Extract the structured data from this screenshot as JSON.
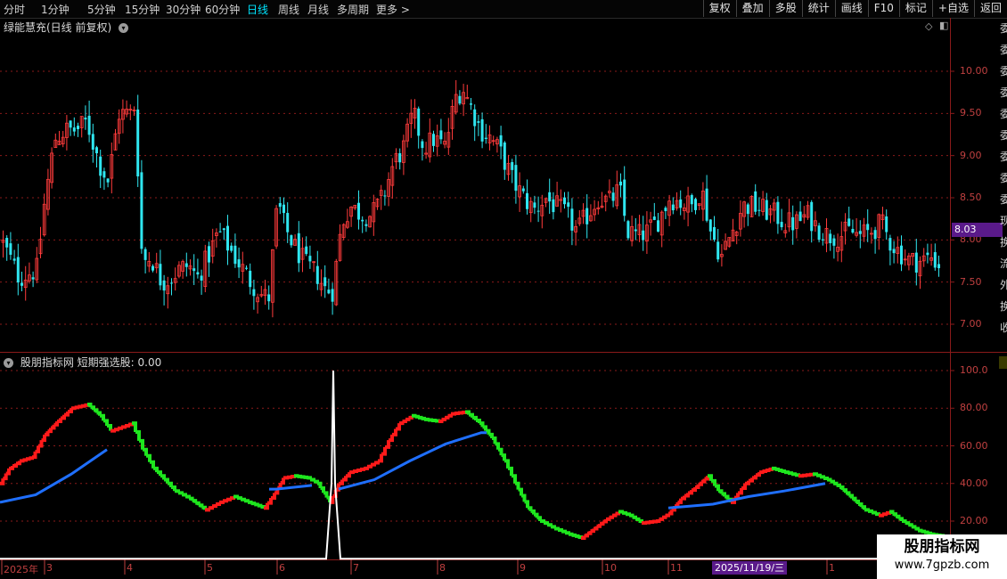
{
  "toolbar": {
    "periods": [
      "分时",
      "1分钟",
      "5分钟",
      "15分钟",
      "30分钟",
      "60分钟",
      "日线",
      "周线",
      "月线",
      "多周期",
      "更多"
    ],
    "active": "日线",
    "more_icon": "chevron-right-icon",
    "buttons": [
      "复权",
      "叠加",
      "多股",
      "统计",
      "画线",
      "F10",
      "标记",
      "+自选",
      "返回"
    ]
  },
  "main_chart": {
    "title": "绿能慧充(日线 前复权)",
    "current_price": "8.03",
    "price_ticks": [
      "10.00",
      "9.50",
      "9.00",
      "8.50",
      "8.00",
      "7.50",
      "7.00"
    ]
  },
  "indicator_chart": {
    "title": "股朋指标网  短期强选股: 0.00",
    "ticks": [
      "100.0",
      "80.00",
      "60.00",
      "40.00",
      "20.00"
    ]
  },
  "date_axis": {
    "labels": [
      "2025年",
      "3",
      "4",
      "5",
      "6",
      "7",
      "8",
      "9",
      "10",
      "11",
      "1"
    ],
    "cursor_date": "2025/11/19/三"
  },
  "side_panel": {
    "text": "委委委委委委委委委现换流外换收"
  },
  "watermark": {
    "line1": "股朋指标网",
    "line2": "www.7gpzb.com"
  },
  "colors": {
    "up": "#ff3b3b",
    "down": "#2fe6f0",
    "line_up": "#ff1a1a",
    "line_down": "#1ee61e",
    "line_blue": "#1f6fff",
    "grid": "#8a1a1a"
  },
  "chart_data": [
    {
      "type": "candlestick",
      "title": "绿能慧充(日线 前复权)",
      "ylim": [
        6.75,
        10.4
      ],
      "close_path": [
        [
          0,
          8.0
        ],
        [
          20,
          7.55
        ],
        [
          40,
          7.65
        ],
        [
          48,
          8.4
        ],
        [
          60,
          9.2
        ],
        [
          72,
          9.3
        ],
        [
          84,
          9.3
        ],
        [
          96,
          9.4
        ],
        [
          110,
          8.9
        ],
        [
          120,
          8.7
        ],
        [
          132,
          9.5
        ],
        [
          145,
          9.5
        ],
        [
          150,
          9.6
        ],
        [
          158,
          7.75
        ],
        [
          168,
          7.8
        ],
        [
          180,
          7.5
        ],
        [
          190,
          7.55
        ],
        [
          200,
          7.65
        ],
        [
          210,
          7.7
        ],
        [
          220,
          7.55
        ],
        [
          232,
          7.8
        ],
        [
          244,
          8.1
        ],
        [
          256,
          7.9
        ],
        [
          268,
          7.7
        ],
        [
          280,
          7.5
        ],
        [
          292,
          7.35
        ],
        [
          300,
          7.3
        ],
        [
          310,
          8.45
        ],
        [
          318,
          8.15
        ],
        [
          330,
          7.9
        ],
        [
          342,
          7.7
        ],
        [
          354,
          7.6
        ],
        [
          364,
          7.4
        ],
        [
          372,
          7.4
        ],
        [
          382,
          8.2
        ],
        [
          392,
          8.4
        ],
        [
          404,
          8.3
        ],
        [
          416,
          8.3
        ],
        [
          428,
          8.5
        ],
        [
          440,
          8.9
        ],
        [
          452,
          9.1
        ],
        [
          462,
          9.5
        ],
        [
          474,
          9.1
        ],
        [
          486,
          9.2
        ],
        [
          498,
          9.1
        ],
        [
          510,
          9.7
        ],
        [
          518,
          9.8
        ],
        [
          526,
          9.6
        ],
        [
          538,
          9.3
        ],
        [
          550,
          9.2
        ],
        [
          562,
          9.0
        ],
        [
          574,
          8.7
        ],
        [
          586,
          8.5
        ],
        [
          598,
          8.35
        ],
        [
          610,
          8.5
        ],
        [
          622,
          8.4
        ],
        [
          634,
          8.3
        ],
        [
          646,
          8.1
        ],
        [
          658,
          8.3
        ],
        [
          670,
          8.5
        ],
        [
          682,
          8.45
        ],
        [
          694,
          8.6
        ],
        [
          702,
          8.1
        ],
        [
          714,
          8.05
        ],
        [
          726,
          8.1
        ],
        [
          738,
          8.25
        ],
        [
          750,
          8.5
        ],
        [
          762,
          8.45
        ],
        [
          774,
          8.4
        ],
        [
          786,
          8.6
        ],
        [
          796,
          8.1
        ],
        [
          808,
          7.8
        ],
        [
          820,
          8.1
        ],
        [
          832,
          8.4
        ],
        [
          844,
          8.4
        ],
        [
          856,
          8.35
        ],
        [
          868,
          8.3
        ],
        [
          880,
          8.2
        ],
        [
          892,
          8.2
        ],
        [
          904,
          8.3
        ],
        [
          916,
          8.15
        ],
        [
          928,
          8.05
        ],
        [
          940,
          8.05
        ],
        [
          952,
          8.1
        ],
        [
          964,
          8.05
        ],
        [
          976,
          8.1
        ],
        [
          988,
          8.2
        ],
        [
          996,
          8.0
        ],
        [
          1008,
          7.85
        ],
        [
          1020,
          7.75
        ],
        [
          1032,
          7.75
        ],
        [
          1044,
          7.8
        ],
        [
          1056,
          7.65
        ]
      ]
    },
    {
      "type": "line",
      "title": "股朋指标网  短期强选股: 0.00",
      "ylim": [
        0,
        103
      ],
      "series": [
        {
          "color_by_slope": true,
          "points": [
            [
              0,
              40
            ],
            [
              10,
              48
            ],
            [
              22,
              52
            ],
            [
              36,
              54
            ],
            [
              50,
              66
            ],
            [
              64,
              73
            ],
            [
              80,
              80
            ],
            [
              98,
              82
            ],
            [
              112,
              76
            ],
            [
              124,
              68
            ],
            [
              136,
              70
            ],
            [
              148,
              72
            ],
            [
              160,
              58
            ],
            [
              172,
              48
            ],
            [
              184,
              42
            ],
            [
              196,
              36
            ],
            [
              212,
              32
            ],
            [
              230,
              26
            ],
            [
              246,
              30
            ],
            [
              262,
              33
            ],
            [
              278,
              30
            ],
            [
              296,
              27
            ],
            [
              308,
              35
            ],
            [
              318,
              43
            ],
            [
              330,
              44
            ],
            [
              344,
              43
            ],
            [
              356,
              40
            ],
            [
              370,
              30
            ],
            [
              380,
              40
            ],
            [
              392,
              46
            ],
            [
              408,
              48
            ],
            [
              424,
              52
            ],
            [
              436,
              63
            ],
            [
              448,
              72
            ],
            [
              462,
              76
            ],
            [
              476,
              74
            ],
            [
              492,
              73
            ],
            [
              506,
              77
            ],
            [
              522,
              78
            ],
            [
              538,
              72
            ],
            [
              552,
              64
            ],
            [
              566,
              52
            ],
            [
              578,
              40
            ],
            [
              592,
              27
            ],
            [
              606,
              20
            ],
            [
              622,
              16
            ],
            [
              638,
              13
            ],
            [
              652,
              11
            ],
            [
              666,
              16
            ],
            [
              680,
              21
            ],
            [
              694,
              25
            ],
            [
              706,
              23
            ],
            [
              720,
              19
            ],
            [
              736,
              20
            ],
            [
              750,
              24
            ],
            [
              764,
              32
            ],
            [
              780,
              38
            ],
            [
              794,
              44
            ],
            [
              806,
              36
            ],
            [
              820,
              30
            ],
            [
              836,
              40
            ],
            [
              852,
              46
            ],
            [
              866,
              48
            ],
            [
              880,
              46
            ],
            [
              896,
              44
            ],
            [
              912,
              45
            ],
            [
              928,
              42
            ],
            [
              942,
              38
            ],
            [
              956,
              32
            ],
            [
              970,
              26
            ],
            [
              986,
              23
            ],
            [
              998,
              25
            ],
            [
              1012,
              20
            ],
            [
              1030,
              15
            ],
            [
              1044,
              13
            ],
            [
              1058,
              12
            ]
          ]
        },
        {
          "color": "#1f6fff",
          "points": [
            [
              0,
              30
            ],
            [
              40,
              34
            ],
            [
              80,
              45
            ],
            [
              120,
              58
            ],
            [
              158,
              65
            ],
            [
              302,
              37
            ],
            [
              310,
              37
            ],
            [
              350,
              39
            ],
            [
              372,
              36
            ],
            [
              380,
              37
            ],
            [
              420,
              42
            ],
            [
              460,
              52
            ],
            [
              500,
              61
            ],
            [
              540,
              67
            ],
            [
              546,
              67
            ],
            [
              740,
              27
            ],
            [
              750,
              27
            ],
            [
              800,
              29
            ],
            [
              840,
              33
            ],
            [
              880,
              36
            ],
            [
              926,
              40
            ]
          ]
        },
        {
          "color": "#ffffff",
          "points": [
            [
              0,
              0
            ],
            [
              366,
              0
            ],
            [
              372,
              40
            ],
            [
              374,
              100
            ],
            [
              376,
              40
            ],
            [
              382,
              0
            ],
            [
              1066,
              0
            ]
          ]
        }
      ]
    }
  ]
}
